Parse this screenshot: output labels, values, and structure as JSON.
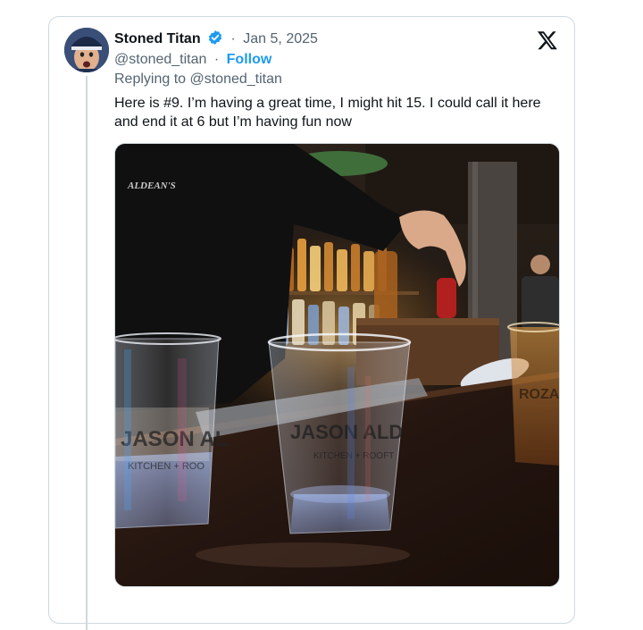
{
  "tweet": {
    "author": {
      "display_name": "Stoned Titan",
      "handle": "@stoned_titan",
      "verified": true,
      "verified_color": "#1d9bf0"
    },
    "date": "Jan 5, 2025",
    "separator": "·",
    "follow_label": "Follow",
    "replying_to": "Replying to @stoned_titan",
    "text": "Here is #9. I’m having a great time, I might hit 15. I could call it here and end it at 6 but I’m having fun now",
    "media": {
      "type": "photo",
      "cup_print": "JASON ALDEAN'S",
      "cup_print_sub": "KITCHEN + ROOFTOP",
      "shirt_logo": "ALDEAN'S"
    }
  },
  "icons": {
    "platform": "x-logo-icon",
    "verified": "verified-badge-icon"
  },
  "colors": {
    "link": "#1d9bf0",
    "secondary_text": "#536471",
    "border": "#cfd9de"
  }
}
